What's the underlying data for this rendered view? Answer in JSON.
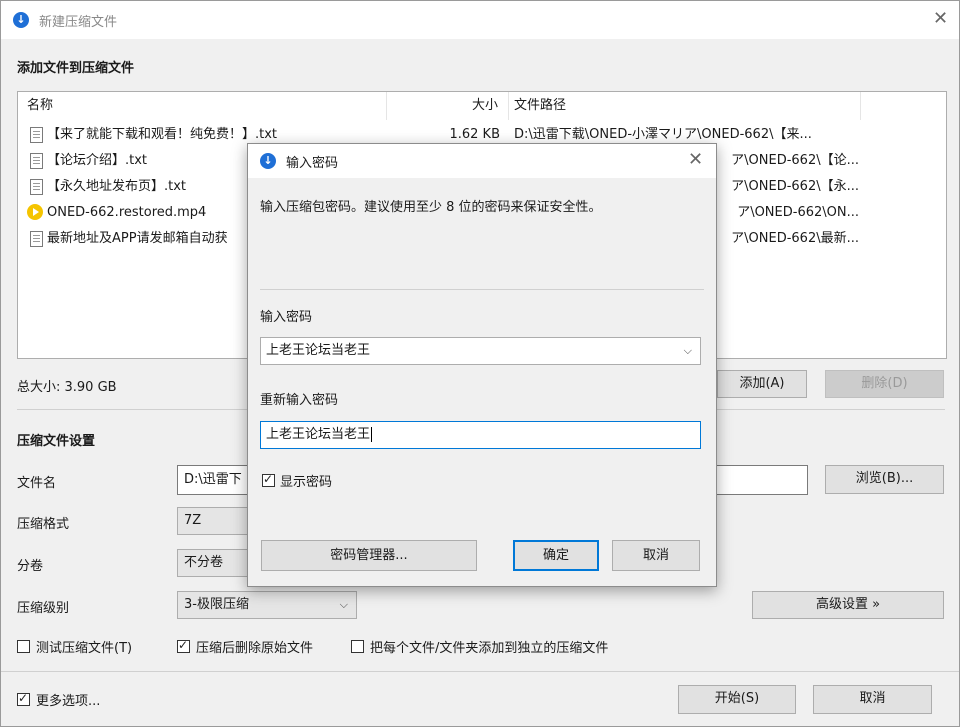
{
  "window": {
    "title": "新建压缩文件",
    "section_add": "添加文件到压缩文件",
    "columns": {
      "name": "名称",
      "size": "大小",
      "path": "文件路径"
    },
    "files": [
      {
        "name": "【来了就能下载和观看！纯免费！】.txt",
        "size": "1.62 KB",
        "path": "D:\\迅雷下载\\ONED-小澤マリア\\ONED-662\\【来...",
        "icon": "text-file-icon"
      },
      {
        "name": "【论坛介绍】.txt",
        "size": "",
        "path": "ア\\ONED-662\\【论...",
        "icon": "text-file-icon"
      },
      {
        "name": "【永久地址发布页】.txt",
        "size": "",
        "path": "ア\\ONED-662\\【永...",
        "icon": "text-file-icon"
      },
      {
        "name": "ONED-662.restored.mp4",
        "size": "",
        "path": "ア\\ONED-662\\ON...",
        "icon": "video-file-icon"
      },
      {
        "name": "最新地址及APP请发邮箱自动获",
        "size": "",
        "path": "ア\\ONED-662\\最新...",
        "icon": "text-file-icon"
      }
    ],
    "total_size": "总大小: 3.90 GB",
    "add_button": "添加(A)",
    "delete_button": "删除(D)",
    "section_settings": "压缩文件设置",
    "filename_label": "文件名",
    "filename_value": "D:\\迅雷下",
    "browse_button": "浏览(B)...",
    "format_label": "压缩格式",
    "format_value": "7Z",
    "split_label": "分卷",
    "split_value": "不分卷",
    "level_label": "压缩级别",
    "level_value": "3-极限压缩",
    "advanced_button": "高级设置 »",
    "test_checkbox": "测试压缩文件(T)",
    "delete_after_checkbox": "压缩后删除原始文件",
    "separate_checkbox": "把每个文件/文件夹添加到独立的压缩文件",
    "more_options_checkbox": "更多选项...",
    "start_button": "开始(S)",
    "cancel_button": "取消",
    "checks": {
      "test": false,
      "delete_after": true,
      "separate": false,
      "more_options": true
    }
  },
  "dialog": {
    "title": "输入密码",
    "description": "输入压缩包密码。建议使用至少 8 位的密码来保证安全性。",
    "password_label": "输入密码",
    "password_value": "上老王论坛当老王",
    "confirm_label": "重新输入密码",
    "confirm_value": "上老王论坛当老王",
    "show_password": "显示密码",
    "show_password_checked": true,
    "manager_button": "密码管理器...",
    "ok_button": "确定",
    "cancel_button": "取消"
  },
  "colors": {
    "accent": "#0078d7",
    "app_icon": "#1f6fd6",
    "video_icon": "#f5c400"
  }
}
